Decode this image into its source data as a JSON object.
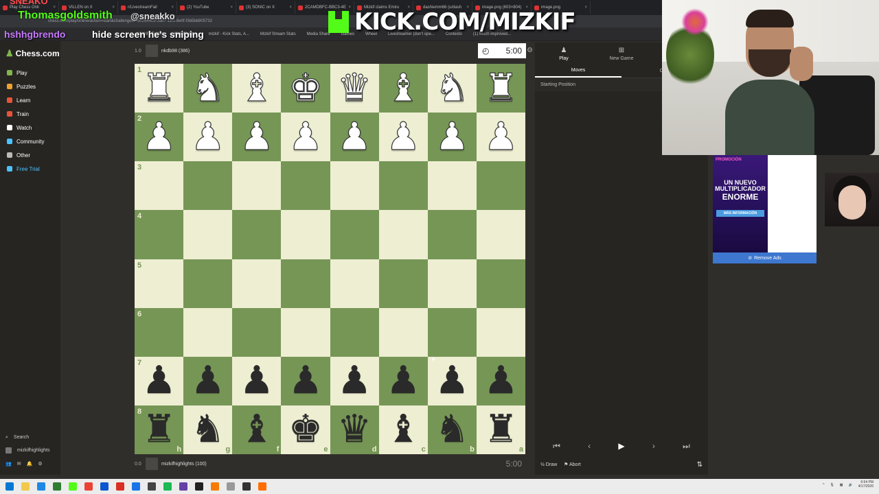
{
  "browser": {
    "tabs": [
      {
        "label": "Play Chess Onli"
      },
      {
        "label": "VILLEN on X"
      },
      {
        "label": "r/LivestreamFail"
      },
      {
        "label": "(2) YouTube"
      },
      {
        "label": "(3) SONIC on X"
      },
      {
        "label": "2CAMDBFC-BBC3-4E"
      },
      {
        "label": "Mizkif claims Emiru"
      },
      {
        "label": "dashiemm66 (u/dash"
      },
      {
        "label": "image.png (603×804)"
      },
      {
        "label": "image.png"
      }
    ],
    "url": "chess.com/play/online/action=start&challengeId=b02644c9-3ab7-11f1-8e0f-f3b5bb905732",
    "bookmarks": [
      "Mizkif - Twitch",
      "Kick Chatb...",
      "mizkif - Kick Stats, A...",
      "Mizkif Stream Stats",
      "Media Share",
      "Games",
      "Wheel",
      "Livestreamer (don't ope...",
      "Contexto",
      "(1) Much improved..."
    ]
  },
  "overlays": {
    "sneako": "SNEAKO",
    "thomas": "Thomasgoldsmith",
    "sneakko": "@sneakko",
    "hsh": "hshhgbrendo",
    "hide": "hide screen he's sniping",
    "kick": "KICK.COM/MIZKIF"
  },
  "sidebar": {
    "logo": "Chess.com",
    "items": [
      {
        "label": "Play",
        "color": "#81b64c"
      },
      {
        "label": "Puzzles",
        "color": "#f0a030"
      },
      {
        "label": "Learn",
        "color": "#e8543a"
      },
      {
        "label": "Train",
        "color": "#e8543a"
      },
      {
        "label": "Watch",
        "color": "#ffffff"
      },
      {
        "label": "Community",
        "color": "#4cc3ff"
      },
      {
        "label": "Other",
        "color": "#bbbbbb"
      },
      {
        "label": "Free Trial",
        "color": "#4cc3ff"
      }
    ],
    "search": "Search",
    "username": "mizkifhighlights"
  },
  "top_player": {
    "score": "1.0",
    "name": "nkdb98 (386)",
    "clock": "5:00"
  },
  "bottom_player": {
    "score": "0.0",
    "name": "mizkifhighlights (100)",
    "clock": "5:00"
  },
  "board": {
    "ranks": [
      "1",
      "2",
      "3",
      "4",
      "5",
      "6",
      "7",
      "8"
    ],
    "files": [
      "h",
      "g",
      "f",
      "e",
      "d",
      "c",
      "b",
      "a"
    ],
    "rows": [
      [
        "wR",
        "wN",
        "wB",
        "wK",
        "wQ",
        "wB",
        "wN",
        "wR"
      ],
      [
        "wP",
        "wP",
        "wP",
        "wP",
        "wP",
        "wP",
        "wP",
        "wP"
      ],
      [
        "",
        "",
        "",
        "",
        "",
        "",
        "",
        ""
      ],
      [
        "",
        "",
        "",
        "",
        "",
        "",
        "",
        ""
      ],
      [
        "",
        "",
        "",
        "",
        "",
        "",
        "",
        ""
      ],
      [
        "",
        "",
        "",
        "",
        "",
        "",
        "",
        ""
      ],
      [
        "bP",
        "bP",
        "bP",
        "bP",
        "bP",
        "bP",
        "bP",
        "bP"
      ],
      [
        "bR",
        "bN",
        "bB",
        "bK",
        "bQ",
        "bB",
        "bN",
        "bR"
      ]
    ]
  },
  "right_panel": {
    "tabs": [
      {
        "label": "Play",
        "icon": "pawn-icon"
      },
      {
        "label": "New Game",
        "icon": "plus-icon"
      },
      {
        "label": "Games",
        "icon": "grid-icon"
      }
    ],
    "subtabs": [
      "Moves",
      "Chat"
    ],
    "starting_position": "Starting Position",
    "draw": "Draw",
    "abort": "Abort"
  },
  "ad": {
    "top": "PROMOCIÓN",
    "line1": "UN NUEVO",
    "line2": "MULTIPLICADOR",
    "line3": "ENORME",
    "cta": "MÁS INFORMACIÓN",
    "remove": "Remove Ads"
  },
  "taskbar": {
    "time": "6:54 PM",
    "date": "4/17/2026"
  }
}
